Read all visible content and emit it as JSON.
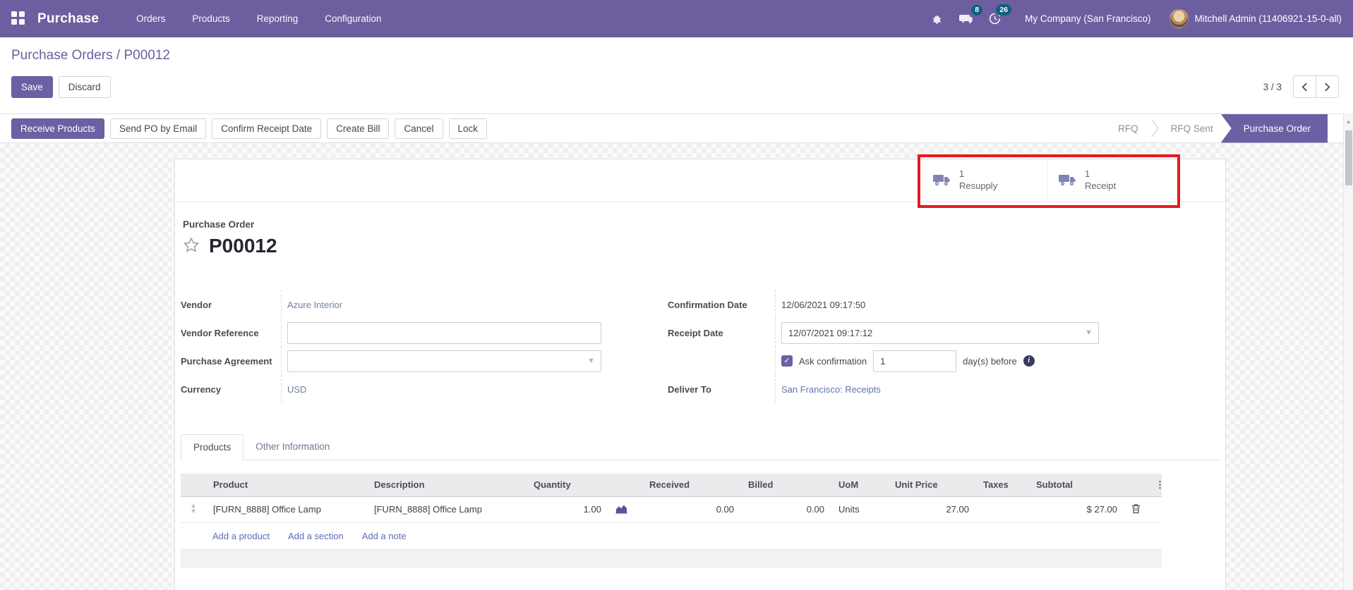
{
  "colors": {
    "accent": "#6d5fa3",
    "annotation_red": "#e51b1f",
    "nav_badge": "#11607a",
    "link": "#5d6cb3",
    "muted_link": "#70809b"
  },
  "navbar": {
    "app_name": "Purchase",
    "menus": [
      {
        "label": "Orders"
      },
      {
        "label": "Products"
      },
      {
        "label": "Reporting"
      },
      {
        "label": "Configuration"
      }
    ],
    "messages_badge": "8",
    "activities_badge": "26",
    "company": "My Company (San Francisco)",
    "user": "Mitchell Admin (11406921-15-0-all)"
  },
  "control_panel": {
    "breadcrumb_parent": "Purchase Orders",
    "breadcrumb_separator": "/",
    "breadcrumb_current": "P00012",
    "save_label": "Save",
    "discard_label": "Discard",
    "pager_value": "3 / 3"
  },
  "statusbar": {
    "primary_button": "Receive Products",
    "buttons": [
      {
        "label": "Send PO by Email"
      },
      {
        "label": "Confirm Receipt Date"
      },
      {
        "label": "Create Bill"
      },
      {
        "label": "Cancel"
      },
      {
        "label": "Lock"
      }
    ],
    "stages": [
      {
        "label": "RFQ"
      },
      {
        "label": "RFQ Sent"
      },
      {
        "label": "Purchase Order"
      }
    ],
    "active_stage": "Purchase Order"
  },
  "smart_buttons": [
    {
      "count": "1",
      "label": "Resupply"
    },
    {
      "count": "1",
      "label": "Receipt"
    }
  ],
  "form": {
    "title_label": "Purchase Order",
    "title": "P00012",
    "vendor_label": "Vendor",
    "vendor_value": "Azure Interior",
    "vendor_reference_label": "Vendor Reference",
    "vendor_reference_value": "",
    "purchase_agreement_label": "Purchase Agreement",
    "purchase_agreement_value": "",
    "currency_label": "Currency",
    "currency_value": "USD",
    "confirmation_date_label": "Confirmation Date",
    "confirmation_date_value": "12/06/2021 09:17:50",
    "receipt_date_label": "Receipt Date",
    "receipt_date_value": "12/07/2021 09:17:12",
    "ask_confirmation_label": "Ask confirmation",
    "ask_confirmation_checked": true,
    "days_value": "1",
    "days_suffix": "day(s) before",
    "deliver_to_label": "Deliver To",
    "deliver_to_value": "San Francisco: Receipts"
  },
  "tabs": [
    {
      "label": "Products"
    },
    {
      "label": "Other Information"
    }
  ],
  "table": {
    "headers": {
      "product": "Product",
      "description": "Description",
      "quantity": "Quantity",
      "received": "Received",
      "billed": "Billed",
      "uom": "UoM",
      "unit_price": "Unit Price",
      "taxes": "Taxes",
      "subtotal": "Subtotal",
      "options_icon": "⋮"
    },
    "rows": [
      {
        "product": "[FURN_8888] Office Lamp",
        "description": "[FURN_8888] Office Lamp",
        "quantity": "1.00",
        "received": "0.00",
        "billed": "0.00",
        "uom": "Units",
        "unit_price": "27.00",
        "taxes": "",
        "subtotal": "$ 27.00"
      }
    ],
    "footer_links": [
      {
        "label": "Add a product"
      },
      {
        "label": "Add a section"
      },
      {
        "label": "Add a note"
      }
    ]
  },
  "misc": {
    "checkmark": "✓",
    "handle_up": "▲",
    "handle_down": "▼",
    "caret": "▼",
    "info_glyph": "i",
    "scroll_up_arrow": "▲"
  }
}
